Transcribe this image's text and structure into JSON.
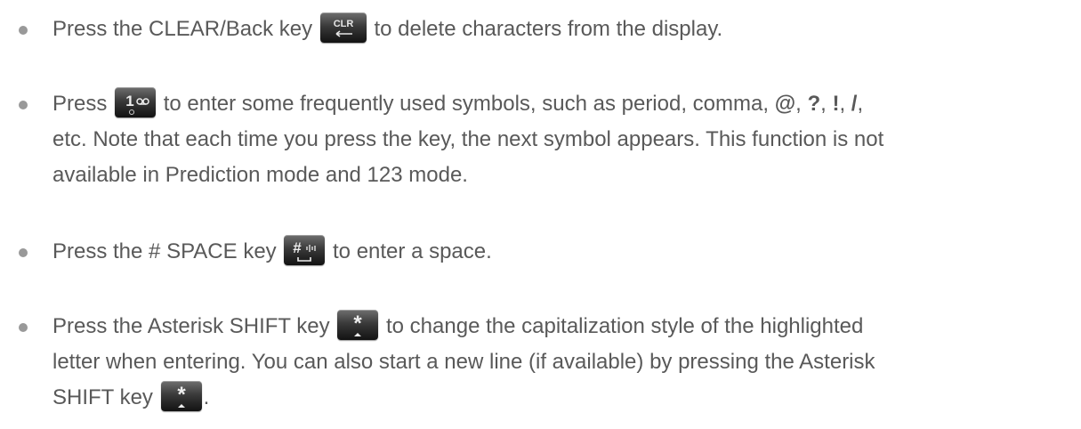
{
  "items": [
    {
      "before": "Press the CLEAR/Back key",
      "after": " to delete characters from the display.",
      "key_label": "CLR"
    },
    {
      "press": "Press",
      "l1a": " to enter some frequently used symbols, such as period, comma, ",
      "at": "@",
      "c1": ", ",
      "q": "?",
      "c2": ", ",
      "ex": "!",
      "c3": ", ",
      "sl": "/",
      "c4": ",",
      "line2": "etc. Note that each time you press the key, the next symbol appears. This function is not",
      "line3": "available in Prediction mode and 123 mode."
    },
    {
      "before": "Press the # SPACE key",
      "after": " to enter a space."
    },
    {
      "before": "Press the Asterisk SHIFT key",
      "after": " to change the capitalization style of the highlighted",
      "line2": "letter when entering. You can also start a new line (if available) by pressing the Asterisk",
      "line3_before": "SHIFT key",
      "line3_after": "."
    }
  ],
  "colors": {
    "text": "#595959",
    "bullet": "#999999",
    "key_dark": "#121212"
  },
  "icons": [
    "clr-key-icon",
    "one-voicemail-key-icon",
    "hash-space-key-icon",
    "asterisk-shift-key-icon"
  ]
}
